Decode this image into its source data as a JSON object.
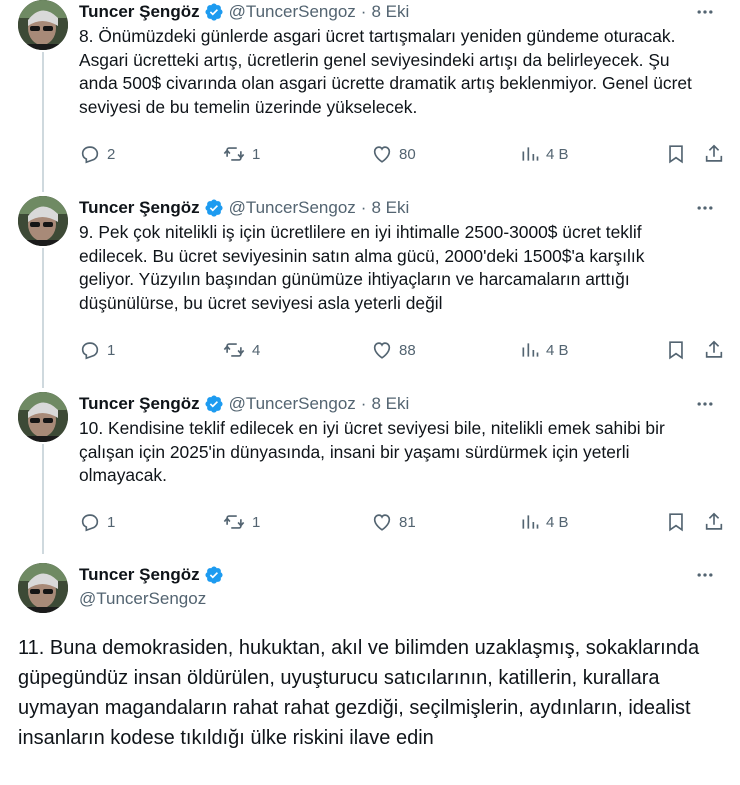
{
  "author": {
    "name": "Tuncer Şengöz",
    "handle": "@TuncerSengoz",
    "sep": "·",
    "verified_color": "#1d9bf0"
  },
  "tweets": [
    {
      "date": "8 Eki",
      "text": "8. Önümüzdeki günlerde asgari ücret tartışmaları yeniden gündeme oturacak. Asgari ücretteki artış, ücretlerin genel seviyesindeki artışı da belirleyecek. Şu anda 500$ civarında olan asgari ücrette dramatik artış beklenmiyor. Genel ücret seviyesi de bu temelin üzerinde yükselecek.",
      "replies": "2",
      "retweets": "1",
      "likes": "80",
      "views": "4 B"
    },
    {
      "date": "8 Eki",
      "text": "9. Pek çok nitelikli iş için ücretlilere en iyi ihtimalle 2500-3000$ ücret teklif edilecek. Bu ücret seviyesinin satın alma gücü, 2000'deki 1500$'a karşılık geliyor. Yüzyılın başından günümüze ihtiyaçların ve harcamaların arttığı düşünülürse, bu ücret seviyesi asla yeterli değil",
      "replies": "1",
      "retweets": "4",
      "likes": "88",
      "views": "4 B"
    },
    {
      "date": "8 Eki",
      "text": "10. Kendisine teklif edilecek en iyi ücret seviyesi bile, nitelikli emek sahibi bir çalışan için 2025'in dünyasında, insani bir yaşamı sürdürmek için yeterli olmayacak.",
      "replies": "1",
      "retweets": "1",
      "likes": "81",
      "views": "4 B"
    }
  ],
  "focused_tweet": {
    "text": "11. Buna demokrasiden, hukuktan, akıl ve bilimden uzaklaşmış, sokaklarında güpegündüz insan öldürülen, uyuşturucu satıcılarının, katillerin, kurallara uymayan magandaların rahat rahat gezdiği, seçilmişlerin, aydınların, idealist insanların kodese tıkıldığı ülke riskini ilave edin"
  },
  "icons": {
    "reply": "reply-icon",
    "retweet": "retweet-icon",
    "like": "heart-icon",
    "views": "views-icon",
    "bookmark": "bookmark-icon",
    "share": "share-icon",
    "more": "more-icon"
  }
}
